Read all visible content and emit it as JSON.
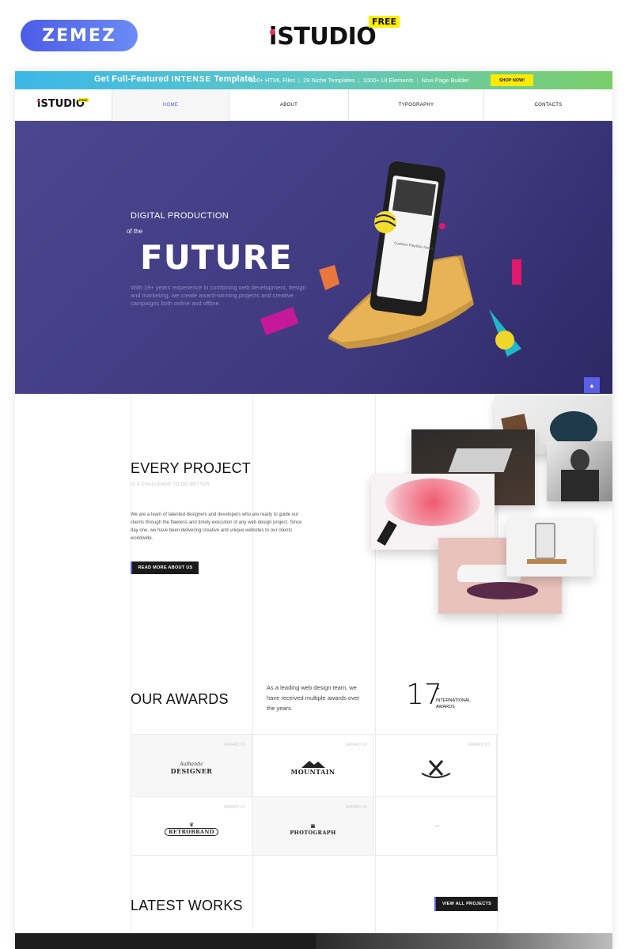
{
  "outer": {
    "brand_left": "ZEMEZ",
    "brand_center_i": "i",
    "brand_center_text": "STUDIO",
    "brand_center_badge": "FREE"
  },
  "promo": {
    "title_prefix": "Get Full-Featured ",
    "title_emph": "INTENSE",
    "title_suffix": " Template!",
    "features": [
      "500+ HTML Files",
      "29 Niche Templates",
      "1000+ UI Elements",
      "Novi Page Builder"
    ],
    "shop_button": "SHOP NOW!"
  },
  "nav": {
    "logo_i": "i",
    "logo_text": "STUDIO",
    "logo_badge": "FREE",
    "items": [
      {
        "label": "HOME",
        "active": true
      },
      {
        "label": "ABOUT"
      },
      {
        "label": "TYPOGRAPHY"
      },
      {
        "label": "CONTACTS"
      }
    ]
  },
  "hero": {
    "kicker": "DIGITAL PRODUCTION",
    "of_the": "of the",
    "title": "FUTURE",
    "description": "With 19+ years' experience in combining web development, design and marketing, we create award-winning projects and creative campaigns both online and offline.",
    "phone_card_title": "Custom Flexible Items",
    "scroll_top_icon": "arrow-up-icon"
  },
  "project": {
    "title": "EVERY PROJECT",
    "subtitle": "IS A CHALLENGE TO DO BETTER",
    "body": "We are a team of talented designers and developers who are ready to guide our clients through the flawless and timely execution of any web design project. Since day one, we have been delivering creative and unique websites to our clients worldwide.",
    "button": "READ MORE ABOUT US"
  },
  "awards": {
    "title": "OUR AWARDS",
    "text": "As a leading web design team, we have received multiple awards over the years.",
    "count": "17",
    "count_suffix": "+",
    "count_label": "INTERNATIONAL AWARDS",
    "items": [
      {
        "num": "AWARD #1",
        "name": "DESIGNER",
        "top": "Authentic"
      },
      {
        "num": "AWARD #2",
        "name": "MOUNTAIN",
        "top": ""
      },
      {
        "num": "AWARD #3",
        "name": "",
        "top": ""
      },
      {
        "num": "AWARD #4",
        "name": "RETROBRAND",
        "top": ""
      },
      {
        "num": "AWARD #5",
        "name": "PHOTOGRAPH",
        "top": ""
      }
    ],
    "next_icon": "arrow-right-icon"
  },
  "works": {
    "title": "LATEST WORKS",
    "button": "VIEW ALL PROJECTS"
  },
  "colors": {
    "accent": "#5a5fe6",
    "hero_bg": "#443f88",
    "promo_start": "#3cb8e8",
    "promo_end": "#7bcf6a",
    "shop_button": "#ffea00"
  }
}
